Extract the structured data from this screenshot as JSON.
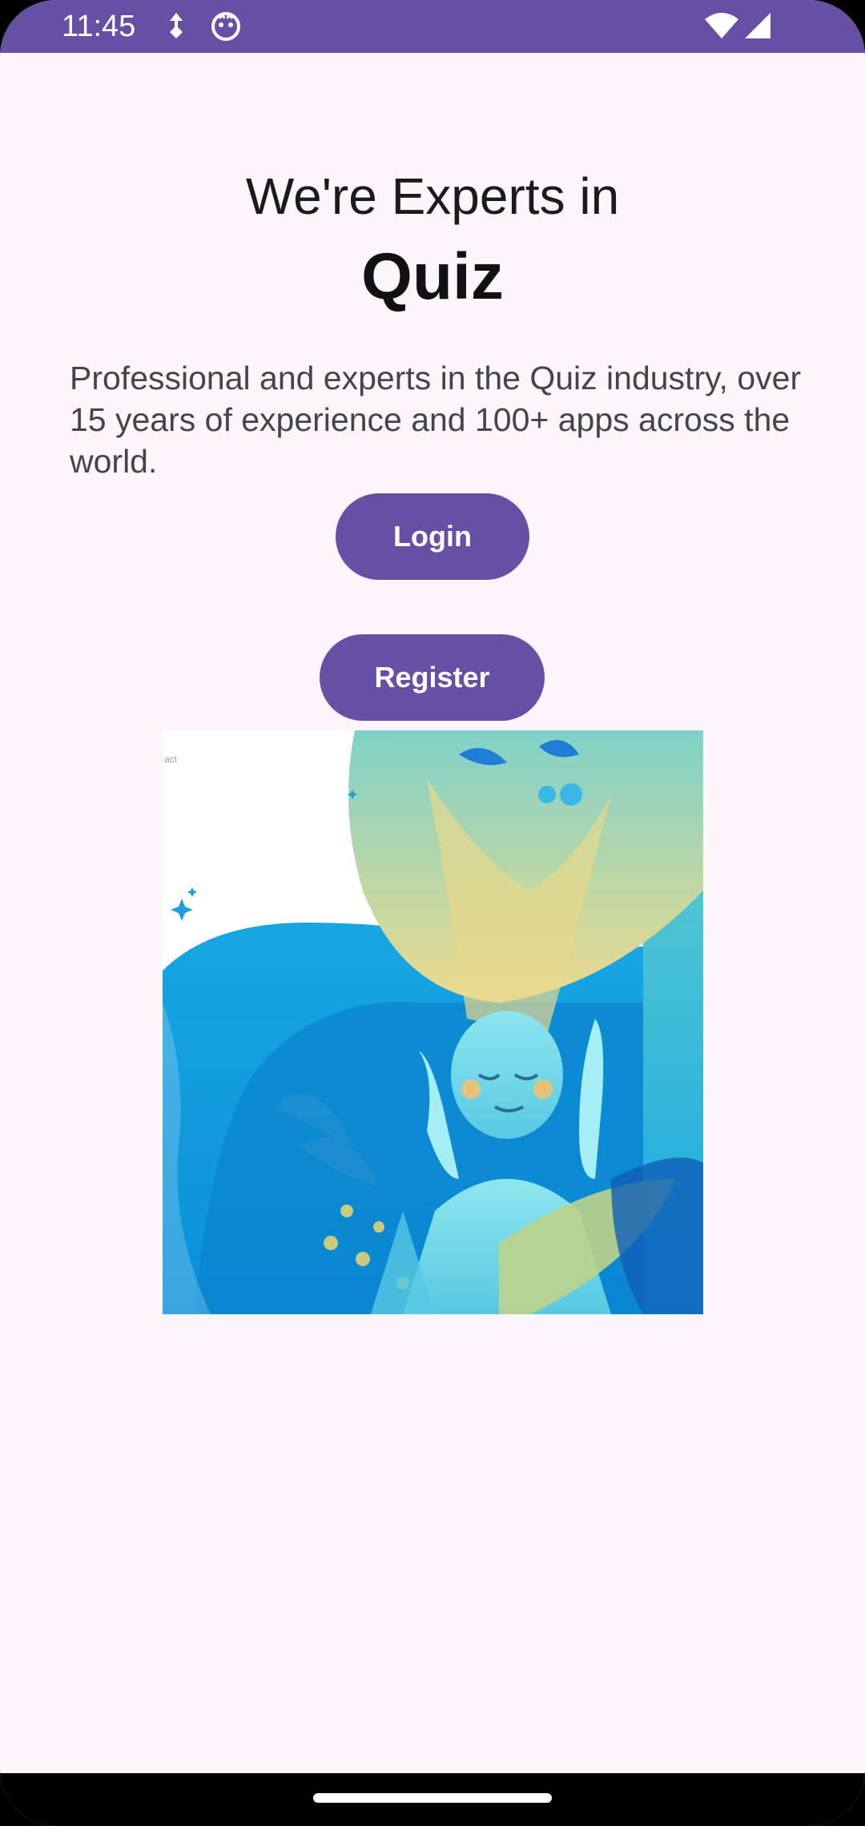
{
  "status_bar": {
    "time": "11:45",
    "background_color": "#6750a4",
    "left_icons": [
      "navigation-arrow-icon",
      "face-notification-icon"
    ],
    "right_icons": [
      "wifi-icon",
      "cellular-signal-icon"
    ]
  },
  "content": {
    "headline": "We're Experts in",
    "title": "Quiz",
    "description": "Professional and experts in the Quiz industry, over 15 years of experience and 100+ apps across the world."
  },
  "buttons": {
    "login_label": "Login",
    "register_label": "Register",
    "color": "#6750a4"
  },
  "hero_image": {
    "subject": "illustration-woman-with-flowing-hair-and-plants",
    "caption_fragment": "act"
  },
  "navigation": {
    "home_indicator": "home-indicator"
  }
}
